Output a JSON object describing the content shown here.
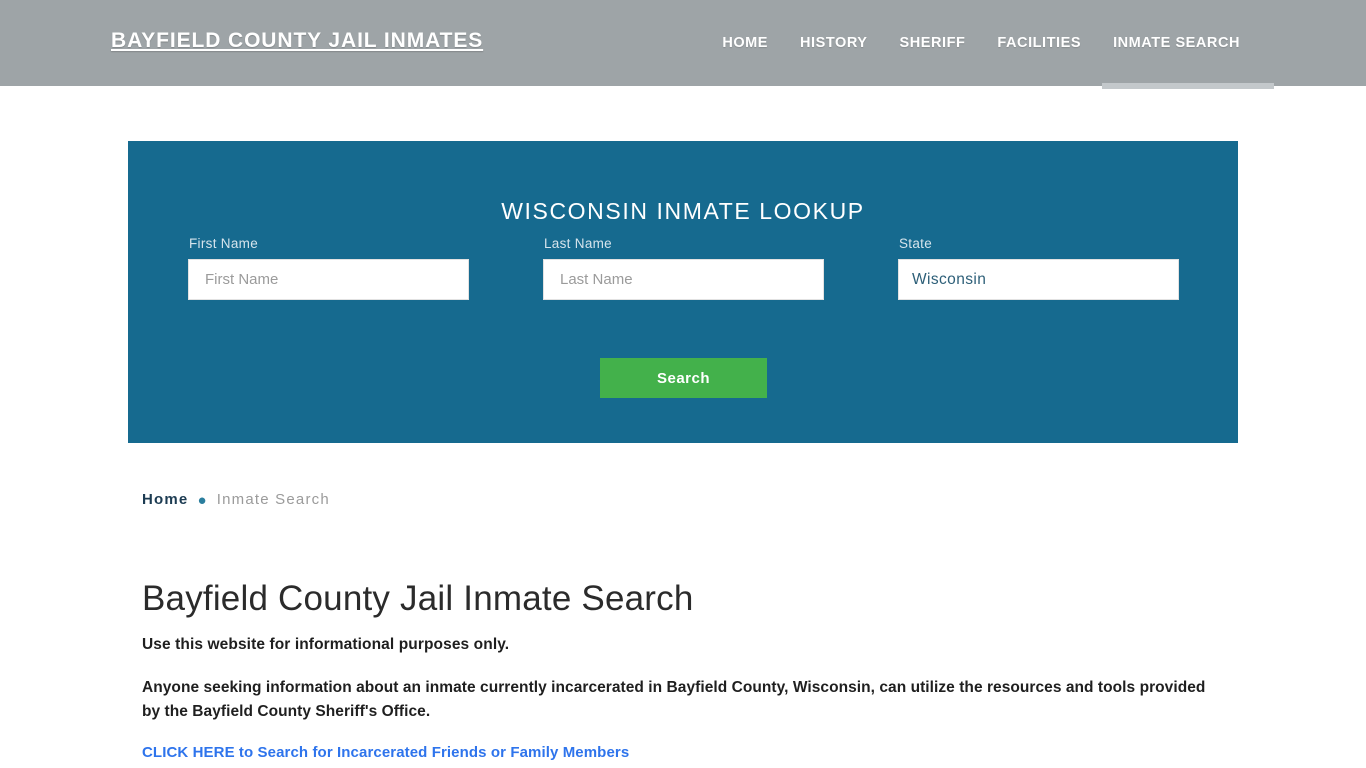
{
  "header": {
    "brand": "BAYFIELD COUNTY JAIL INMATES",
    "nav": [
      {
        "label": "HOME",
        "active": false
      },
      {
        "label": "HISTORY",
        "active": false
      },
      {
        "label": "SHERIFF",
        "active": false
      },
      {
        "label": "FACILITIES",
        "active": false
      },
      {
        "label": "INMATE SEARCH",
        "active": true
      }
    ],
    "bar_color": "#9ea4a7"
  },
  "lookup": {
    "title": "WISCONSIN INMATE LOOKUP",
    "panel_color": "#166a8f",
    "fields": {
      "first_name": {
        "label": "First Name",
        "value": "",
        "placeholder": "First Name"
      },
      "last_name": {
        "label": "Last Name",
        "value": "",
        "placeholder": "Last Name"
      },
      "state": {
        "label": "State",
        "value": "Wisconsin",
        "options": [
          "Wisconsin"
        ]
      }
    },
    "search_label": "Search",
    "search_color": "#43b14b"
  },
  "breadcrumb": {
    "home": "Home",
    "separator": "●",
    "current": "Inmate Search"
  },
  "main": {
    "title": "Bayfield County Jail Inmate Search",
    "lede": "Use this website for informational purposes only.",
    "paragraph": "Anyone seeking information about an inmate currently incarcerated in Bayfield County, Wisconsin, can utilize the resources and tools provided by the Bayfield County Sheriff's Office.",
    "cta": "CLICK HERE to Search for Incarcerated Friends or Family Members",
    "cta_color": "#2e74ec"
  }
}
